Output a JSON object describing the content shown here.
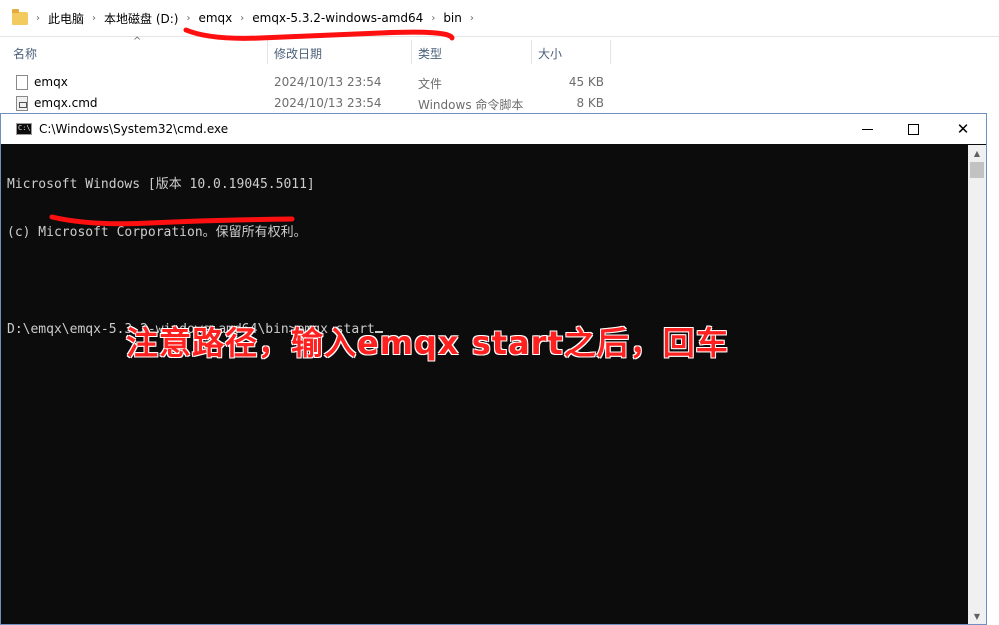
{
  "explorer": {
    "breadcrumbs": [
      "此电脑",
      "本地磁盘 (D:)",
      "emqx",
      "emqx-5.3.2-windows-amd64",
      "bin"
    ],
    "columns": {
      "name": "名称",
      "modified": "修改日期",
      "type": "类型",
      "size": "大小"
    },
    "files": [
      {
        "name": "emqx",
        "modified": "2024/10/13 23:54",
        "type": "文件",
        "size": "45 KB",
        "icon": "file-icon"
      },
      {
        "name": "emqx.cmd",
        "modified": "2024/10/13 23:54",
        "type": "Windows 命令脚本",
        "size": "8 KB",
        "icon": "cmd-file-icon"
      }
    ]
  },
  "cmd": {
    "title": "C:\\Windows\\System32\\cmd.exe",
    "icon_label": "C:\\",
    "lines": [
      "Microsoft Windows [版本 10.0.19045.5011]",
      "(c) Microsoft Corporation。保留所有权利。",
      "",
      "D:\\emqx\\emqx-5.3.2-windows-amd64\\bin>emqx start"
    ]
  },
  "annotation": {
    "text": "注意路径，输入emqx start之后，回车",
    "color": "#ff2020"
  }
}
